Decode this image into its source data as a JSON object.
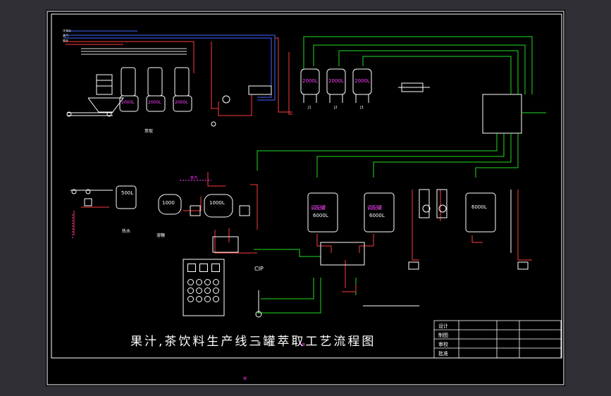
{
  "title": "果汁,茶饮料生产线三罐萃取工艺流程图",
  "title_block": {
    "row1": "设计",
    "row2": "制图",
    "row3": "审校",
    "row4": "批准"
  },
  "tanks_top": [
    "2000L",
    "2000L",
    "2000L"
  ],
  "tanks_left": [
    "2000L",
    "2000L",
    "2000L"
  ],
  "tank_tags_top": [
    "J1",
    "J2",
    "J3"
  ],
  "tanks_mid": {
    "hot_water": "500L",
    "dissolve": "1000",
    "extract": "1000L"
  },
  "tanks_blend": [
    {
      "label": "调配罐",
      "volume": "6000L"
    },
    {
      "label": "调配罐",
      "volume": "6000L"
    },
    {
      "label": "",
      "volume": "6000L"
    }
  ],
  "labels": {
    "cip": "CIP",
    "hot_water": "热水",
    "dissolve": "溶糖",
    "extract": "萃取",
    "steam": "蒸汽",
    "drain1": "排",
    "drain2": "排",
    "drain3": "排",
    "tag_left_top1": "冷却水",
    "tag_left_top2": "蒸汽",
    "tag_left_top3": "热水"
  },
  "colors": {
    "pipe_green": "#22dd22",
    "pipe_red": "#ff3b3b",
    "pipe_blue": "#4466ff",
    "line_white": "#ffffff",
    "accent_magenta": "#ff44ff",
    "background": "#000000"
  }
}
